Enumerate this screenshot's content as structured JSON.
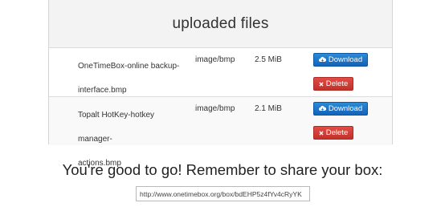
{
  "panel": {
    "title": "uploaded files"
  },
  "files": [
    {
      "name_line1": "OneTimeBox-online backup-",
      "name_line2": "interface.bmp",
      "type": "image/bmp",
      "size": "2.5 MiB",
      "download_label": "Download",
      "delete_label": "Delete"
    },
    {
      "name_line1": "Topalt HotKey-hotkey manager-",
      "name_line2": "actions.bmp",
      "type": "image/bmp",
      "size": "2.1 MiB",
      "download_label": "Download",
      "delete_label": "Delete"
    }
  ],
  "share": {
    "headline": "You're good to go! Remember to share your box:",
    "url": "http://www.onetimebox.org/box/bdEHP5z4fYv4cRyYK"
  },
  "icons": {
    "download": "cloud-download-icon",
    "delete": "close-icon"
  },
  "colors": {
    "download_button": "#1a6fc7",
    "delete_button": "#d13e37"
  }
}
